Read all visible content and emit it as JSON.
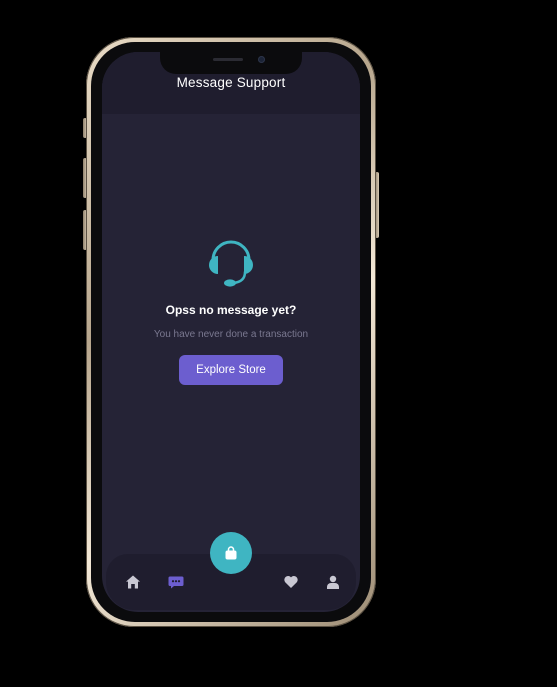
{
  "header": {
    "title": "Message Support"
  },
  "empty_state": {
    "icon": "headset-icon",
    "title": "Opss no message yet?",
    "subtitle": "You have never done a transaction",
    "button_label": "Explore Store"
  },
  "bottom_nav": {
    "items": [
      {
        "icon": "home-icon",
        "active": false
      },
      {
        "icon": "chat-icon",
        "active": true
      },
      {
        "icon": "heart-icon",
        "active": false
      },
      {
        "icon": "profile-icon",
        "active": false
      }
    ],
    "fab_icon": "shopping-bag-icon"
  },
  "colors": {
    "background": "#252336",
    "surface": "#1f1d2e",
    "accent": "#6c5ecf",
    "teal": "#3fb5c2",
    "inactive_icon": "#c9c8d3",
    "subtitle_text": "#7a7890"
  }
}
